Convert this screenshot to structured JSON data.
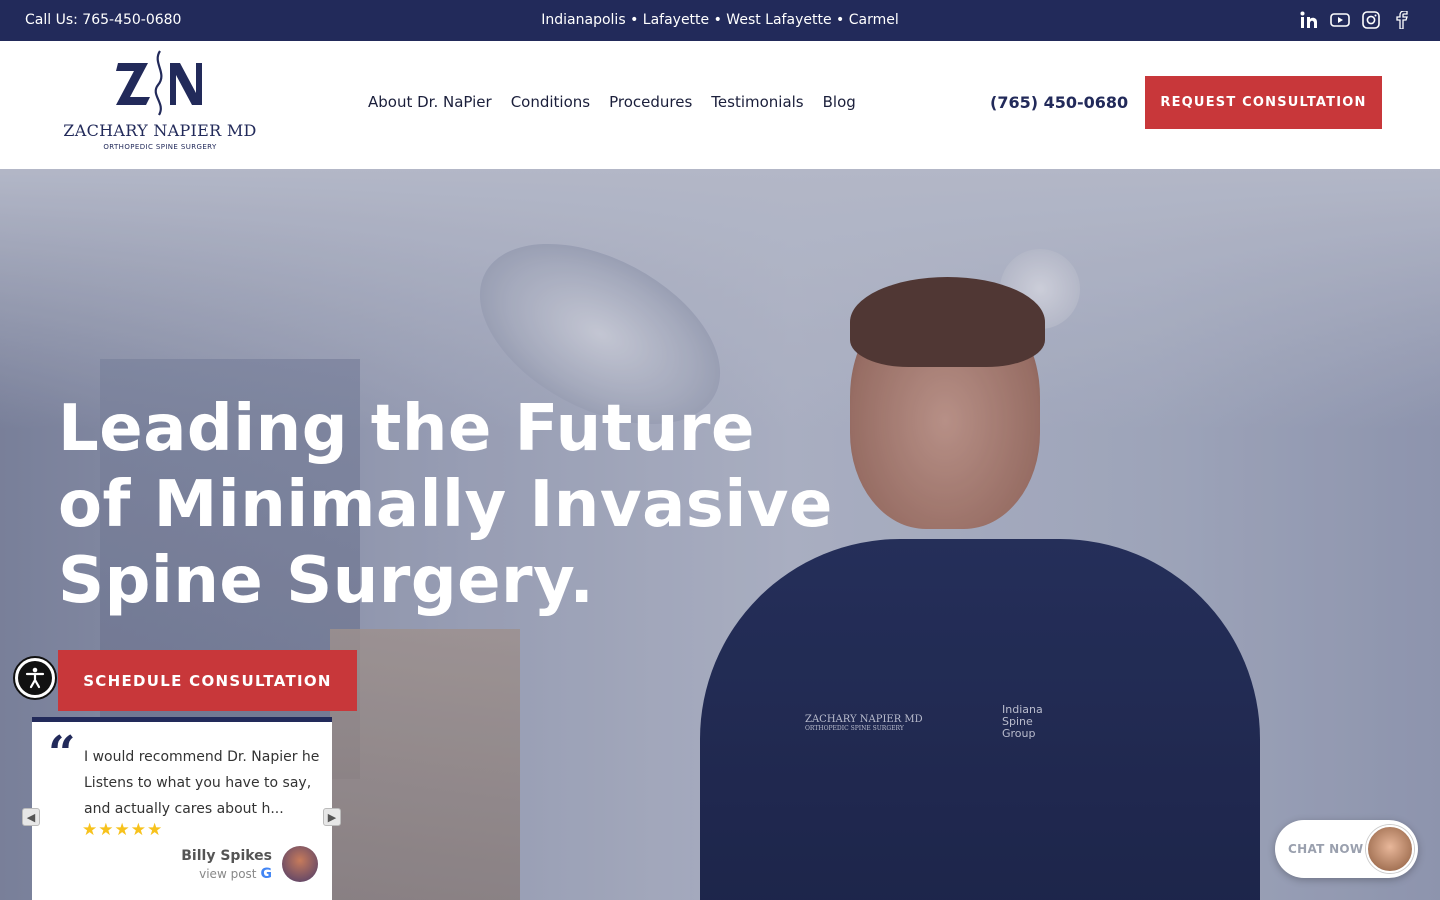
{
  "topbar": {
    "call": "Call Us: 765-450-0680",
    "cities": "Indianapolis • Lafayette • West Lafayette • Carmel",
    "social": [
      "linkedin-icon",
      "youtube-icon",
      "instagram-icon",
      "facebook-icon"
    ]
  },
  "header": {
    "logo_name": "ZACHARY NAPIER MD",
    "logo_sub": "ORTHOPEDIC SPINE SURGERY",
    "nav": {
      "about": "About Dr. NaPier",
      "conditions": "Conditions",
      "procedures": "Procedures",
      "testimonials": "Testimonials",
      "blog": "Blog"
    },
    "phone": "(765) 450-0680",
    "request_btn": "REQUEST CONSULTATION"
  },
  "hero": {
    "line1": "Leading the Future",
    "line2": "of Minimally Invasive",
    "line3": "Spine Surgery.",
    "schedule_btn": "SCHEDULE CONSULTATION",
    "scrub_name": "ZACHARY NAPIER MD",
    "scrub_sub": "ORTHOPEDIC SPINE SURGERY",
    "scrub_logo": "Indiana Spine Group"
  },
  "review": {
    "text": "I would recommend Dr. Napier he Listens to what you have to say, and actually cares about h...",
    "stars": "★★★★★",
    "name": "Billy Spikes",
    "view_post": "view post"
  },
  "chat": {
    "label": "CHAT NOW"
  },
  "colors": {
    "navy": "#222a5a",
    "red": "#c8373a"
  }
}
